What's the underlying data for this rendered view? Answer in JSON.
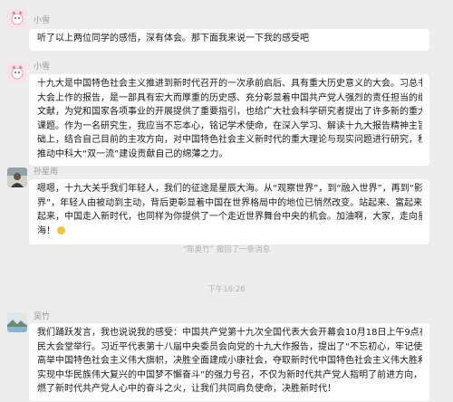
{
  "messages": [
    {
      "sender": "小雪",
      "lines": [
        "听了以上两位同学的感悟，深有体会。那下面我来说一下我的感受吧"
      ]
    },
    {
      "sender": "小雪",
      "lines": [
        "十九大是中国特色社会主义推进到新时代召开的一次承前启后、具有重大历史意义的大会。习总书记在",
        "大会上作的报告，是一部具有宏大而厚重的历史感、充分彰显着中国共产党人强烈的责任担当的纲领性",
        "文献，为党和国家各项事业的开展提供了重要指引，也给广大社会科学研究者提出了许多新的重大研究",
        "课题。作为一名研究生，我应当不忘本心，铭记学术使命，在深入学习、解读十九大报告精神主旨的基",
        "础上，结合自己目前的主攻方向，对中国特色社会主义新时代的重大理论与现实问题进行研究，积极为",
        "推动中科大“双一流”建设贡献自己的绵薄之力。"
      ]
    },
    {
      "sender": "孙星雨",
      "lines": [
        "嗯嗯，十九大关乎我们年轻人，我们的征途是星辰大海。从“观察世界”，到“融入世界”，再到“影响世",
        "界”，年轻人由被动到主动，背后更彰显着中国在世界格局中的地位已悄然改变。站起来、富起来、强",
        "起来，中国走入新时代，也同样为你提供了一个走近世界舞台中央的机会。加油啊，大家，走向星辰大",
        "海！"
      ],
      "emoji": "thumbs-up-emoji"
    },
    {
      "sender": "吴竹",
      "lines": [
        "我们踊跃发言，我也说说我的感受：中国共产党第十九次全国代表大会开幕会10月18日上午9点在人",
        "民大会堂举行。习近平代表第十八届中央委员会向党的十九大作报告，提出了“不忘初心，牢记使命，",
        "高举中国特色社会主义伟大旗帜，决胜全面建成小康社会，夺取新时代中国特色社会主义伟大胜利，为",
        "实现中华民族伟大复兴的中国梦不懈奋斗”的强力号召，不仅为新时代共产党人指明了前进方向，也点",
        "燃了新时代共产党人心中的奋斗之火，让我们共同肩负使命，决胜新时代！"
      ]
    }
  ],
  "system_notice": {
    "name": "“陈奥竹”",
    "text": " 撤回了一条消息"
  },
  "timestamp": "下午16:26",
  "colors": {
    "background": "#ededed",
    "bubble": "#ffffff",
    "meta_text": "#999999",
    "avatar_pink": "#f4c8d2"
  }
}
